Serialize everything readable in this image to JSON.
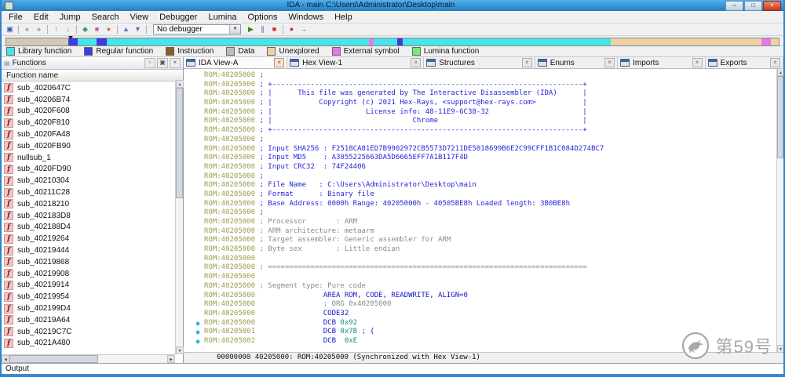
{
  "palette": {
    "addr": "#9c9c4e",
    "cmt": "#2626d8",
    "acmt": "#8a8a8a",
    "insn": "#1414cc",
    "num": "#0f8c8c"
  },
  "window": {
    "title": "IDA - main C:\\Users\\Administrator\\Desktop\\main",
    "controls": [
      {
        "name": "minimize",
        "glyph": "–"
      },
      {
        "name": "maximize",
        "glyph": "□"
      },
      {
        "name": "close",
        "glyph": "×"
      }
    ]
  },
  "menu": {
    "items": [
      "File",
      "Edit",
      "Jump",
      "Search",
      "View",
      "Debugger",
      "Lumina",
      "Options",
      "Windows",
      "Help"
    ]
  },
  "toolbar": {
    "icons_left": [
      {
        "name": "save-icon",
        "glyph": "▣",
        "color": "#2b5fa5"
      },
      {
        "sep": true
      },
      {
        "name": "back-icon",
        "glyph": "«",
        "color": "#44639a"
      },
      {
        "name": "forward-icon",
        "glyph": "»",
        "color": "#44639a"
      },
      {
        "sep": true
      },
      {
        "name": "jump-up-icon",
        "glyph": "↑",
        "color": "#3a7ca8"
      },
      {
        "name": "jump-down-icon",
        "glyph": "↓",
        "color": "#3a7ca8"
      },
      {
        "sep": true
      },
      {
        "name": "data-icon",
        "glyph": "◆",
        "color": "#3aa05a"
      },
      {
        "name": "structs-icon",
        "glyph": "■",
        "color": "#c05aa0"
      },
      {
        "name": "enums-icon",
        "glyph": "●",
        "color": "#c07a2a"
      },
      {
        "sep": true
      },
      {
        "name": "search-up-icon",
        "glyph": "▲",
        "color": "#4a7ab8"
      },
      {
        "name": "search-down-icon",
        "glyph": "▼",
        "color": "#4a7ab8"
      },
      {
        "sep": true
      }
    ],
    "debugger_combo": {
      "value": "No debugger"
    },
    "icons_right": [
      {
        "name": "start-debug-icon",
        "glyph": "▶",
        "color": "#2a8a2a"
      },
      {
        "name": "pause-debug-icon",
        "glyph": "∥",
        "color": "#2a6ab8"
      },
      {
        "name": "stop-debug-icon",
        "glyph": "■",
        "color": "#c03030"
      },
      {
        "sep": true
      },
      {
        "name": "breakpoint-icon",
        "glyph": "●",
        "color": "#c03030"
      },
      {
        "name": "step-icon",
        "glyph": "→",
        "color": "#44639a"
      }
    ]
  },
  "navband": {
    "pointer_pct": 8,
    "segments": [
      {
        "color": "#d4c9b4",
        "width": 8
      },
      {
        "color": "#3d3de0",
        "width": 1.2
      },
      {
        "color": "#49e3ea",
        "width": 2.5
      },
      {
        "color": "#3d3de0",
        "width": 1.3
      },
      {
        "color": "#49e3ea",
        "width": 34
      },
      {
        "color": "#e878e8",
        "width": 0.6
      },
      {
        "color": "#49e3ea",
        "width": 3
      },
      {
        "color": "#3d3de0",
        "width": 0.7
      },
      {
        "color": "#49e3ea",
        "width": 27
      },
      {
        "color": "#ecd2a4",
        "width": 19.5
      },
      {
        "color": "#e878e8",
        "width": 1.2
      },
      {
        "color": "#ecd2a4",
        "width": 1
      }
    ]
  },
  "legend": {
    "items": [
      {
        "label": "Library function",
        "color": "#49e3ea"
      },
      {
        "label": "Regular function",
        "color": "#3d3de0"
      },
      {
        "label": "Instruction",
        "color": "#8a5c28"
      },
      {
        "label": "Data",
        "color": "#bdbdbd"
      },
      {
        "label": "Unexplored",
        "color": "#ecd2a4"
      },
      {
        "label": "External symbol",
        "color": "#e878e8"
      },
      {
        "label": "Lumina function",
        "color": "#7ae87a"
      }
    ]
  },
  "functions_panel": {
    "title": "Functions",
    "header_icons": [
      {
        "name": "dock-icon",
        "glyph": "▫"
      },
      {
        "name": "float-icon",
        "glyph": "▣"
      },
      {
        "name": "close-panel-icon",
        "glyph": "×"
      }
    ],
    "column_header": "Function name",
    "items": [
      "sub_4020647C",
      "sub_40206B74",
      "sub_4020F608",
      "sub_4020F810",
      "sub_4020FA48",
      "sub_4020FB90",
      "nullsub_1",
      "sub_4020FD90",
      "sub_40210304",
      "sub_40211C28",
      "sub_40218210",
      "sub_402183D8",
      "sub_402188D4",
      "sub_40219264",
      "sub_40219444",
      "sub_40219868",
      "sub_40219908",
      "sub_40219914",
      "sub_40219954",
      "sub_402199D4",
      "sub_40219A64",
      "sub_40219C7C",
      "sub_4021A480"
    ]
  },
  "tabs": [
    {
      "label": "IDA View-A",
      "active": true,
      "width_pct": 17.3
    },
    {
      "label": "Hex View-1",
      "active": false,
      "width_pct": 22.8
    },
    {
      "label": "Structures",
      "active": false,
      "width_pct": 18.5
    },
    {
      "label": "Enums",
      "active": false,
      "width_pct": 13.8
    },
    {
      "label": "Imports",
      "active": false,
      "width_pct": 14.6
    },
    {
      "label": "Exports",
      "active": false,
      "width_pct": 13.0
    }
  ],
  "disassembly": {
    "status_line": "00000000 40205000: ROM:40205000 (Synchronized with Hex View-1)",
    "lines": [
      {
        "addr": "ROM:40205000",
        "marker": false,
        "parts": [
          {
            "t": " ;",
            "c": "cmt"
          }
        ]
      },
      {
        "addr": "ROM:40205000",
        "marker": false,
        "parts": [
          {
            "t": " ; +-------------------------------------------------------------------------+",
            "c": "cmt"
          }
        ]
      },
      {
        "addr": "ROM:40205000",
        "marker": false,
        "parts": [
          {
            "t": " ; |      This file was generated by The Interactive Disassembler (IDA)      |",
            "c": "cmt"
          }
        ]
      },
      {
        "addr": "ROM:40205000",
        "marker": false,
        "parts": [
          {
            "t": " ; |           Copyright (c) 2021 Hex-Rays, <support@hex-rays.com>           |",
            "c": "cmt"
          }
        ]
      },
      {
        "addr": "ROM:40205000",
        "marker": false,
        "parts": [
          {
            "t": " ; |                      License info: 48-11E9-6C38-32                      |",
            "c": "cmt"
          }
        ]
      },
      {
        "addr": "ROM:40205000",
        "marker": false,
        "parts": [
          {
            "t": " ; |                                 Chrome                                  |",
            "c": "cmt"
          }
        ]
      },
      {
        "addr": "ROM:40205000",
        "marker": false,
        "parts": [
          {
            "t": " ; +-------------------------------------------------------------------------+",
            "c": "cmt"
          }
        ]
      },
      {
        "addr": "ROM:40205000",
        "marker": false,
        "parts": [
          {
            "t": " ;",
            "c": "cmt"
          }
        ]
      },
      {
        "addr": "ROM:40205000",
        "marker": false,
        "parts": [
          {
            "t": " ; Input SHA256 : F2518CA81ED7B9902972CB5573D7211DE5018699B6E2C99CFF1B1C084D274BC7",
            "c": "cmt"
          }
        ]
      },
      {
        "addr": "ROM:40205000",
        "marker": false,
        "parts": [
          {
            "t": " ; Input MD5    : A3055225663DA5D6665EFF7A1B117F4D",
            "c": "cmt"
          }
        ]
      },
      {
        "addr": "ROM:40205000",
        "marker": false,
        "parts": [
          {
            "t": " ; Input CRC32  : 74F24406",
            "c": "cmt"
          }
        ]
      },
      {
        "addr": "ROM:40205000",
        "marker": false,
        "parts": [
          {
            "t": " ;",
            "c": "cmt"
          }
        ]
      },
      {
        "addr": "ROM:40205000",
        "marker": false,
        "parts": [
          {
            "t": " ; File Name   : C:\\Users\\Administrator\\Desktop\\main",
            "c": "cmt"
          }
        ]
      },
      {
        "addr": "ROM:40205000",
        "marker": false,
        "parts": [
          {
            "t": " ; Format      : Binary file",
            "c": "cmt"
          }
        ]
      },
      {
        "addr": "ROM:40205000",
        "marker": false,
        "parts": [
          {
            "t": " ; Base Address: 0000h Range: 40205000h - 40505BE8h Loaded length: 3B0BE8h",
            "c": "cmt"
          }
        ]
      },
      {
        "addr": "ROM:40205000",
        "marker": false,
        "parts": [
          {
            "t": " ;",
            "c": "cmt"
          }
        ]
      },
      {
        "addr": "ROM:40205000",
        "marker": false,
        "parts": [
          {
            "t": " ; Processor       : ARM",
            "c": "acmt"
          }
        ]
      },
      {
        "addr": "ROM:40205000",
        "marker": false,
        "parts": [
          {
            "t": " ; ARM architecture: metaarm",
            "c": "acmt"
          }
        ]
      },
      {
        "addr": "ROM:40205000",
        "marker": false,
        "parts": [
          {
            "t": " ; Target assembler: Generic assembler for ARM",
            "c": "acmt"
          }
        ]
      },
      {
        "addr": "ROM:40205000",
        "marker": false,
        "parts": [
          {
            "t": " ; Byte sex        : Little endian",
            "c": "acmt"
          }
        ]
      },
      {
        "addr": "ROM:40205000",
        "marker": false,
        "parts": []
      },
      {
        "addr": "ROM:40205000",
        "marker": false,
        "parts": [
          {
            "t": " ; ===========================================================================",
            "c": "acmt"
          }
        ]
      },
      {
        "addr": "ROM:40205000",
        "marker": false,
        "parts": []
      },
      {
        "addr": "ROM:40205000",
        "marker": false,
        "parts": [
          {
            "t": " ; Segment type: Pure code",
            "c": "acmt"
          }
        ]
      },
      {
        "addr": "ROM:40205000",
        "marker": false,
        "parts": [
          {
            "t": "                AREA ROM, CODE, READWRITE, ALIGN=0",
            "c": "insn"
          }
        ]
      },
      {
        "addr": "ROM:40205000",
        "marker": false,
        "parts": [
          {
            "t": "                ; ORG 0x40205000",
            "c": "acmt"
          }
        ]
      },
      {
        "addr": "ROM:40205000",
        "marker": false,
        "parts": [
          {
            "t": "                CODE32",
            "c": "insn"
          }
        ]
      },
      {
        "addr": "ROM:40205000",
        "marker": true,
        "parts": [
          {
            "t": "                DCB ",
            "c": "insn"
          },
          {
            "t": "0x92",
            "c": "num"
          }
        ]
      },
      {
        "addr": "ROM:40205001",
        "marker": true,
        "parts": [
          {
            "t": "                DCB ",
            "c": "insn"
          },
          {
            "t": "0x7B",
            "c": "num"
          },
          {
            "t": " ; {",
            "c": "cmt"
          }
        ]
      },
      {
        "addr": "ROM:40205002",
        "marker": true,
        "parts": [
          {
            "t": "                DCB  ",
            "c": "insn"
          },
          {
            "t": "0xE",
            "c": "num"
          }
        ]
      }
    ]
  },
  "output_panel": {
    "title": "Output"
  },
  "watermark": {
    "text": "第59号"
  }
}
